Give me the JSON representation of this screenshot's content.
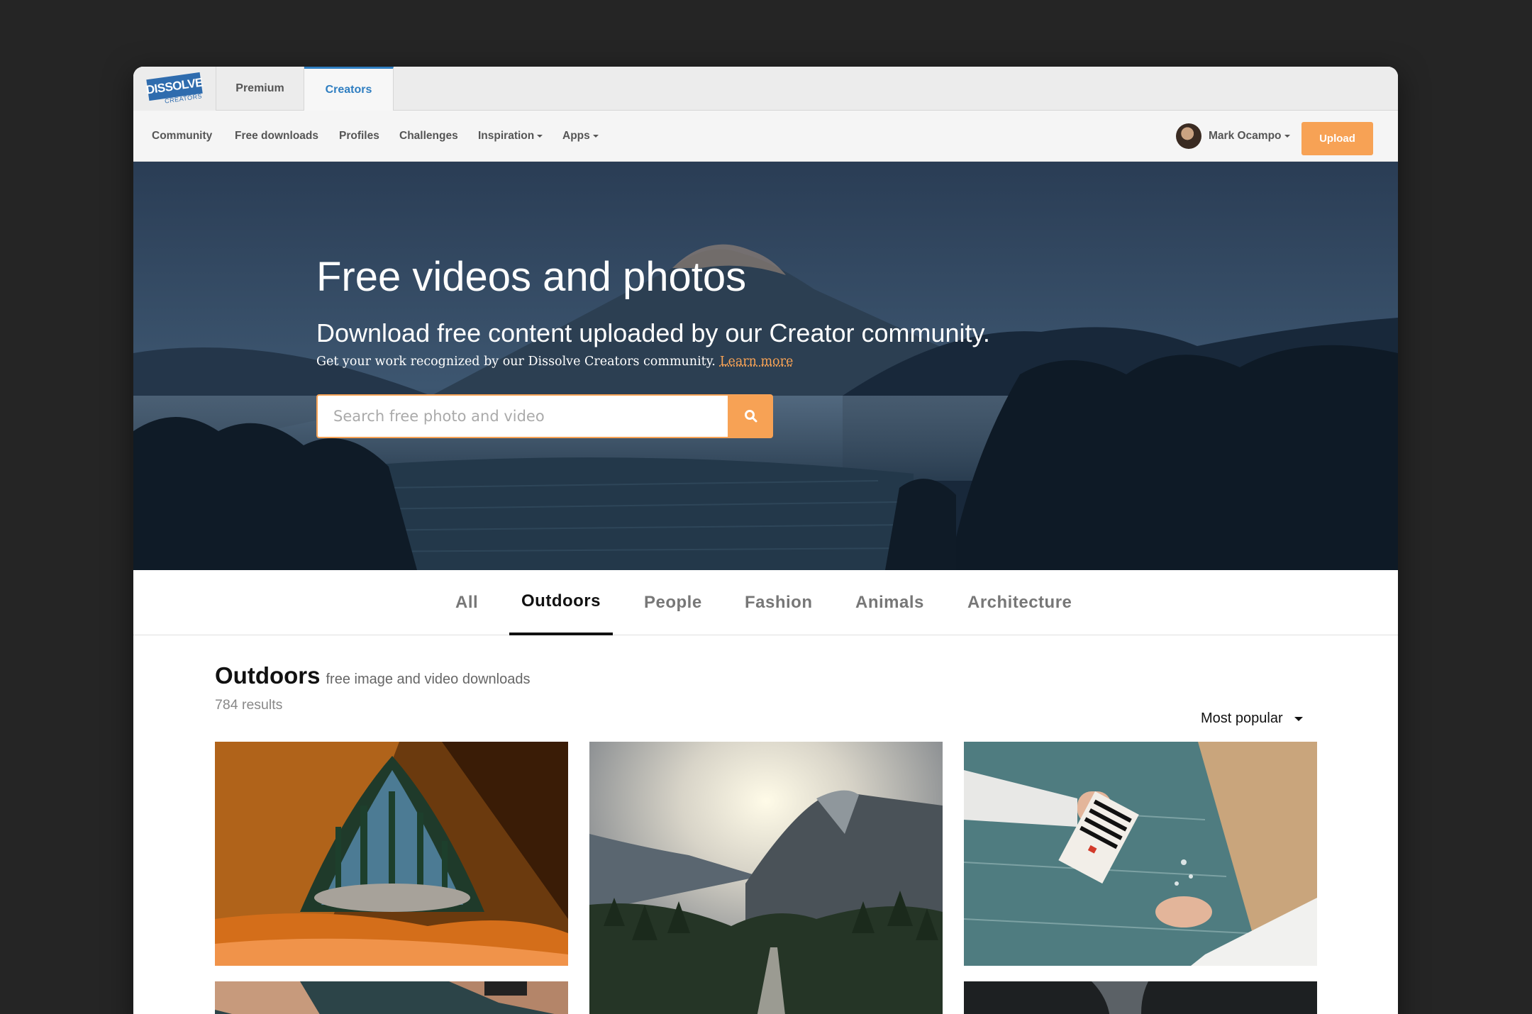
{
  "brand": {
    "logo": "DISSOLVE",
    "logo_sub": "CREATORS"
  },
  "top_tabs": [
    {
      "label": "Premium"
    },
    {
      "label": "Creators"
    }
  ],
  "nav": {
    "items": [
      {
        "label": "Community"
      },
      {
        "label": "Free downloads"
      },
      {
        "label": "Profiles"
      },
      {
        "label": "Challenges"
      },
      {
        "label": "Inspiration"
      },
      {
        "label": "Apps"
      }
    ],
    "user_name": "Mark Ocampo",
    "upload_label": "Upload"
  },
  "hero": {
    "title": "Free videos and photos",
    "subtitle": "Download free content uploaded by our Creator community.",
    "small": "Get your work recognized by our Dissolve Creators community.",
    "learn_more": "Learn more",
    "search_placeholder": "Search free photo and video"
  },
  "categories": [
    {
      "label": "All"
    },
    {
      "label": "Outdoors"
    },
    {
      "label": "People"
    },
    {
      "label": "Fashion"
    },
    {
      "label": "Animals"
    },
    {
      "label": "Architecture"
    }
  ],
  "section": {
    "title": "Outdoors",
    "subtitle": "free image and video downloads",
    "results": "784 results",
    "sort": "Most popular"
  },
  "colors": {
    "accent": "#f7a255",
    "brand": "#2f7ec1"
  }
}
